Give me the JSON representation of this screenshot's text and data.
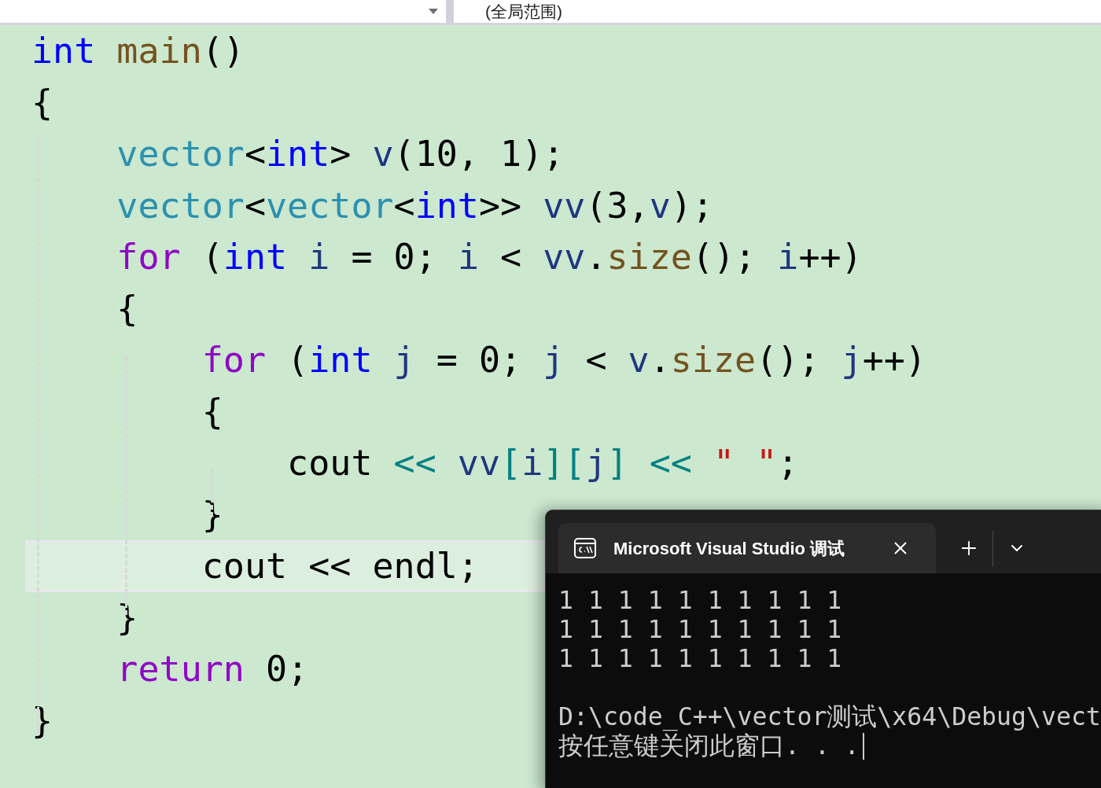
{
  "navigation_bar": {
    "scope": "(全局范围)"
  },
  "code_lines": [
    {
      "current": false,
      "tokens": [
        {
          "text": "int",
          "kind": "keyword"
        },
        {
          "text": " main",
          "kind": "function"
        },
        {
          "text": "()",
          "kind": "plain"
        }
      ]
    },
    {
      "current": false,
      "tokens": [
        {
          "text": "{",
          "kind": "plain"
        }
      ]
    },
    {
      "current": false,
      "tokens": [
        {
          "text": "    vector",
          "kind": "type"
        },
        {
          "text": "<",
          "kind": "plain"
        },
        {
          "text": "int",
          "kind": "keyword"
        },
        {
          "text": "> ",
          "kind": "plain"
        },
        {
          "text": "v",
          "kind": "variable"
        },
        {
          "text": "(10, 1);",
          "kind": "plain"
        }
      ]
    },
    {
      "current": false,
      "tokens": [
        {
          "text": "    vector",
          "kind": "type"
        },
        {
          "text": "<",
          "kind": "plain"
        },
        {
          "text": "vector",
          "kind": "type"
        },
        {
          "text": "<",
          "kind": "plain"
        },
        {
          "text": "int",
          "kind": "keyword"
        },
        {
          "text": ">> ",
          "kind": "plain"
        },
        {
          "text": "vv",
          "kind": "variable"
        },
        {
          "text": "(3,",
          "kind": "plain"
        },
        {
          "text": "v",
          "kind": "variable"
        },
        {
          "text": ");",
          "kind": "plain"
        }
      ]
    },
    {
      "current": false,
      "tokens": [
        {
          "text": "    for",
          "kind": "control"
        },
        {
          "text": " (",
          "kind": "plain"
        },
        {
          "text": "int",
          "kind": "keyword"
        },
        {
          "text": " i",
          "kind": "variable"
        },
        {
          "text": " = 0; ",
          "kind": "plain"
        },
        {
          "text": "i",
          "kind": "variable"
        },
        {
          "text": " < ",
          "kind": "plain"
        },
        {
          "text": "vv",
          "kind": "variable"
        },
        {
          "text": ".",
          "kind": "plain"
        },
        {
          "text": "size",
          "kind": "function"
        },
        {
          "text": "(); ",
          "kind": "plain"
        },
        {
          "text": "i",
          "kind": "variable"
        },
        {
          "text": "++)",
          "kind": "plain"
        }
      ]
    },
    {
      "current": false,
      "tokens": [
        {
          "text": "    {",
          "kind": "plain"
        }
      ]
    },
    {
      "current": false,
      "tokens": [
        {
          "text": "        for",
          "kind": "control"
        },
        {
          "text": " (",
          "kind": "plain"
        },
        {
          "text": "int",
          "kind": "keyword"
        },
        {
          "text": " j",
          "kind": "variable"
        },
        {
          "text": " = 0; ",
          "kind": "plain"
        },
        {
          "text": "j",
          "kind": "variable"
        },
        {
          "text": " < ",
          "kind": "plain"
        },
        {
          "text": "v",
          "kind": "variable"
        },
        {
          "text": ".",
          "kind": "plain"
        },
        {
          "text": "size",
          "kind": "function"
        },
        {
          "text": "(); ",
          "kind": "plain"
        },
        {
          "text": "j",
          "kind": "variable"
        },
        {
          "text": "++)",
          "kind": "plain"
        }
      ]
    },
    {
      "current": false,
      "tokens": [
        {
          "text": "        {",
          "kind": "plain"
        }
      ]
    },
    {
      "current": false,
      "tokens": [
        {
          "text": "            cout ",
          "kind": "plain"
        },
        {
          "text": "<<",
          "kind": "operator"
        },
        {
          "text": " vv",
          "kind": "variable"
        },
        {
          "text": "[",
          "kind": "operator"
        },
        {
          "text": "i",
          "kind": "variable"
        },
        {
          "text": "][",
          "kind": "operator"
        },
        {
          "text": "j",
          "kind": "variable"
        },
        {
          "text": "]",
          "kind": "operator"
        },
        {
          "text": " <<",
          "kind": "operator"
        },
        {
          "text": " \" \"",
          "kind": "string"
        },
        {
          "text": ";",
          "kind": "plain"
        }
      ]
    },
    {
      "current": false,
      "tokens": [
        {
          "text": "        }",
          "kind": "plain"
        }
      ]
    },
    {
      "current": true,
      "tokens": [
        {
          "text": "        cout << endl;",
          "kind": "plain"
        }
      ]
    },
    {
      "current": false,
      "tokens": [
        {
          "text": "    }",
          "kind": "plain"
        }
      ]
    },
    {
      "current": false,
      "tokens": [
        {
          "text": "    return",
          "kind": "control"
        },
        {
          "text": " 0;",
          "kind": "plain"
        }
      ]
    },
    {
      "current": false,
      "tokens": [
        {
          "text": "}",
          "kind": "plain"
        }
      ]
    }
  ],
  "console": {
    "tab_title": "Microsoft Visual Studio 调试",
    "output": [
      "1 1 1 1 1 1 1 1 1 1",
      "1 1 1 1 1 1 1 1 1 1",
      "1 1 1 1 1 1 1 1 1 1"
    ],
    "messages": [
      "D:\\code_C++\\vector测试\\x64\\Debug\\vect",
      "按任意键关闭此窗口. . ."
    ]
  }
}
